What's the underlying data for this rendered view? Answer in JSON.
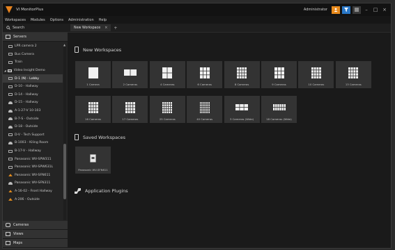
{
  "app": {
    "title": "VI MonitorPlus"
  },
  "titlebar": {
    "user": "Administrator",
    "buttons": [
      {
        "icon": "user-icon",
        "color": "#e88a1c"
      },
      {
        "icon": "filter-icon",
        "color": "#2a78c8"
      },
      {
        "icon": "menu-icon",
        "color": "#3a3a3a"
      }
    ],
    "window_controls": [
      "–",
      "□",
      "×"
    ]
  },
  "menu": [
    "Workspaces",
    "Modules",
    "Options",
    "Administration",
    "Help"
  ],
  "sidebar": {
    "search_label": "Search",
    "servers_label": "Servers",
    "tree": [
      {
        "label": "LPR camera 2",
        "icon": "camera-icon",
        "indent": 8
      },
      {
        "label": "Bus Camera",
        "icon": "camera-icon",
        "indent": 8
      },
      {
        "label": "Train",
        "icon": "camera-icon",
        "indent": 8
      },
      {
        "label": "Video Insight Demo",
        "icon": "server-icon",
        "indent": 2
      },
      {
        "label": "D-1 (N) - Lobby",
        "icon": "camera-icon",
        "indent": 8,
        "selected": true
      },
      {
        "label": "D-10 - Hallway",
        "icon": "camera-icon",
        "indent": 8
      },
      {
        "label": "D-14 - Hallway",
        "icon": "camera-icon",
        "indent": 8
      },
      {
        "label": "D-15 - Hallway",
        "icon": "dome-icon",
        "indent": 8
      },
      {
        "label": "A-1-27-V 10-103",
        "icon": "dome-icon",
        "indent": 8
      },
      {
        "label": "B-7-S - Outside",
        "icon": "dome-icon",
        "indent": 8
      },
      {
        "label": "D-18 - Outside",
        "icon": "dome-icon",
        "indent": 8
      },
      {
        "label": "D-V - Tech Support",
        "icon": "camera-icon",
        "indent": 8
      },
      {
        "label": "B-1003 - Kiling Room",
        "icon": "dome-icon",
        "indent": 8
      },
      {
        "label": "B-17-V - Hallway",
        "icon": "camera-icon",
        "indent": 8
      },
      {
        "label": "Panasonic WV-SPW311",
        "icon": "camera-icon",
        "indent": 8
      },
      {
        "label": "Panasonic WV-SPW631L",
        "icon": "camera-icon",
        "indent": 8
      },
      {
        "label": "Panasonic WV-SFN611",
        "icon": "warning-icon",
        "indent": 8
      },
      {
        "label": "Panasonic WV-SFN311",
        "icon": "dome-icon",
        "indent": 8
      },
      {
        "label": "A-16-02 - Front Hallway",
        "icon": "warning-icon",
        "indent": 8
      },
      {
        "label": "A-206 - Outside",
        "icon": "warning-icon",
        "indent": 8
      }
    ],
    "bottom": [
      {
        "label": "Cameras",
        "icon": "camera-group-icon"
      },
      {
        "label": "Views",
        "icon": "views-icon"
      },
      {
        "label": "Maps",
        "icon": "maps-icon"
      }
    ]
  },
  "tabs": [
    {
      "label": "New Workspace",
      "close": "×"
    }
  ],
  "tab_add": "+",
  "new_workspaces": {
    "title": "New Workspaces",
    "tiles": [
      {
        "label": "1 Camera",
        "icon": "layout-1-icon"
      },
      {
        "label": "2 Cameras",
        "icon": "layout-2-icon"
      },
      {
        "label": "4 Cameras",
        "icon": "layout-4-icon"
      },
      {
        "label": "6 Cameras",
        "icon": "layout-6-icon"
      },
      {
        "label": "8 Cameras",
        "icon": "layout-8-icon"
      },
      {
        "label": "9 Cameras",
        "icon": "layout-9-icon"
      },
      {
        "label": "10 Cameras",
        "icon": "layout-10-icon"
      },
      {
        "label": "13 Cameras",
        "icon": "layout-13-icon"
      },
      {
        "label": "16 Cameras",
        "icon": "layout-16-icon"
      },
      {
        "label": "17 Cameras",
        "icon": "layout-17-icon"
      },
      {
        "label": "25 Cameras",
        "icon": "layout-25-icon"
      },
      {
        "label": "40 Cameras",
        "icon": "layout-40-icon"
      },
      {
        "label": "3 Cameras (Wide)",
        "icon": "layout-wide-3-icon"
      },
      {
        "label": "18 Cameras (Wide)",
        "icon": "layout-wide-18-icon"
      }
    ]
  },
  "saved_workspaces": {
    "title": "Saved Workspaces",
    "tiles": [
      {
        "label": "Panasonic WV-SFN611",
        "icon": "saved-workspace-icon"
      }
    ]
  },
  "plugins": {
    "title": "Application Plugins"
  }
}
